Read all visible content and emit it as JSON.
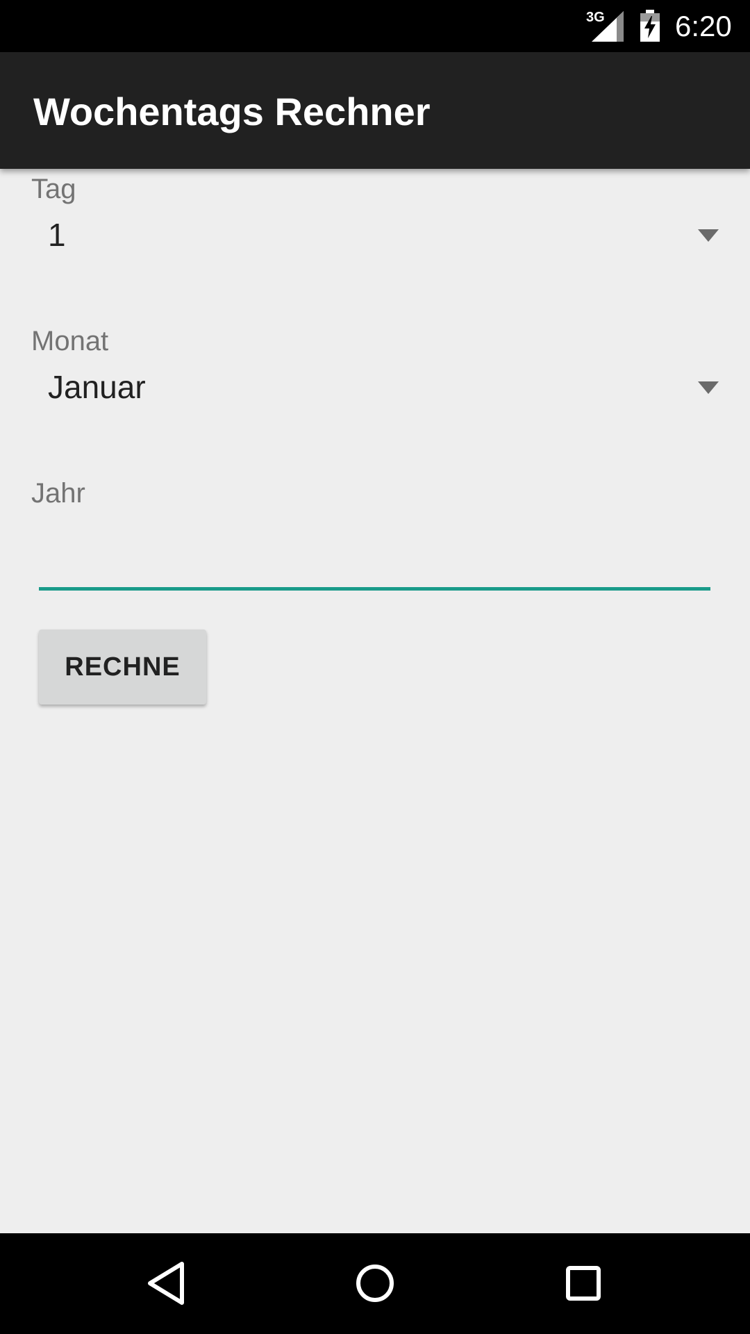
{
  "status_bar": {
    "network": "3G",
    "time": "6:20",
    "icons": [
      "signal-icon",
      "battery-charging-icon"
    ]
  },
  "app_bar": {
    "title": "Wochentags Rechner"
  },
  "form": {
    "day": {
      "label": "Tag",
      "selected": "1"
    },
    "month": {
      "label": "Monat",
      "selected": "Januar"
    },
    "year": {
      "label": "Jahr",
      "value": ""
    },
    "calculate_button": "RECHNE"
  },
  "nav_bar": {
    "icons": [
      "back-icon",
      "home-icon",
      "recents-icon"
    ]
  },
  "colors": {
    "app_bar": "#212121",
    "accent": "#1a9b8a",
    "background": "#eeeeee",
    "button": "#d6d7d7"
  }
}
